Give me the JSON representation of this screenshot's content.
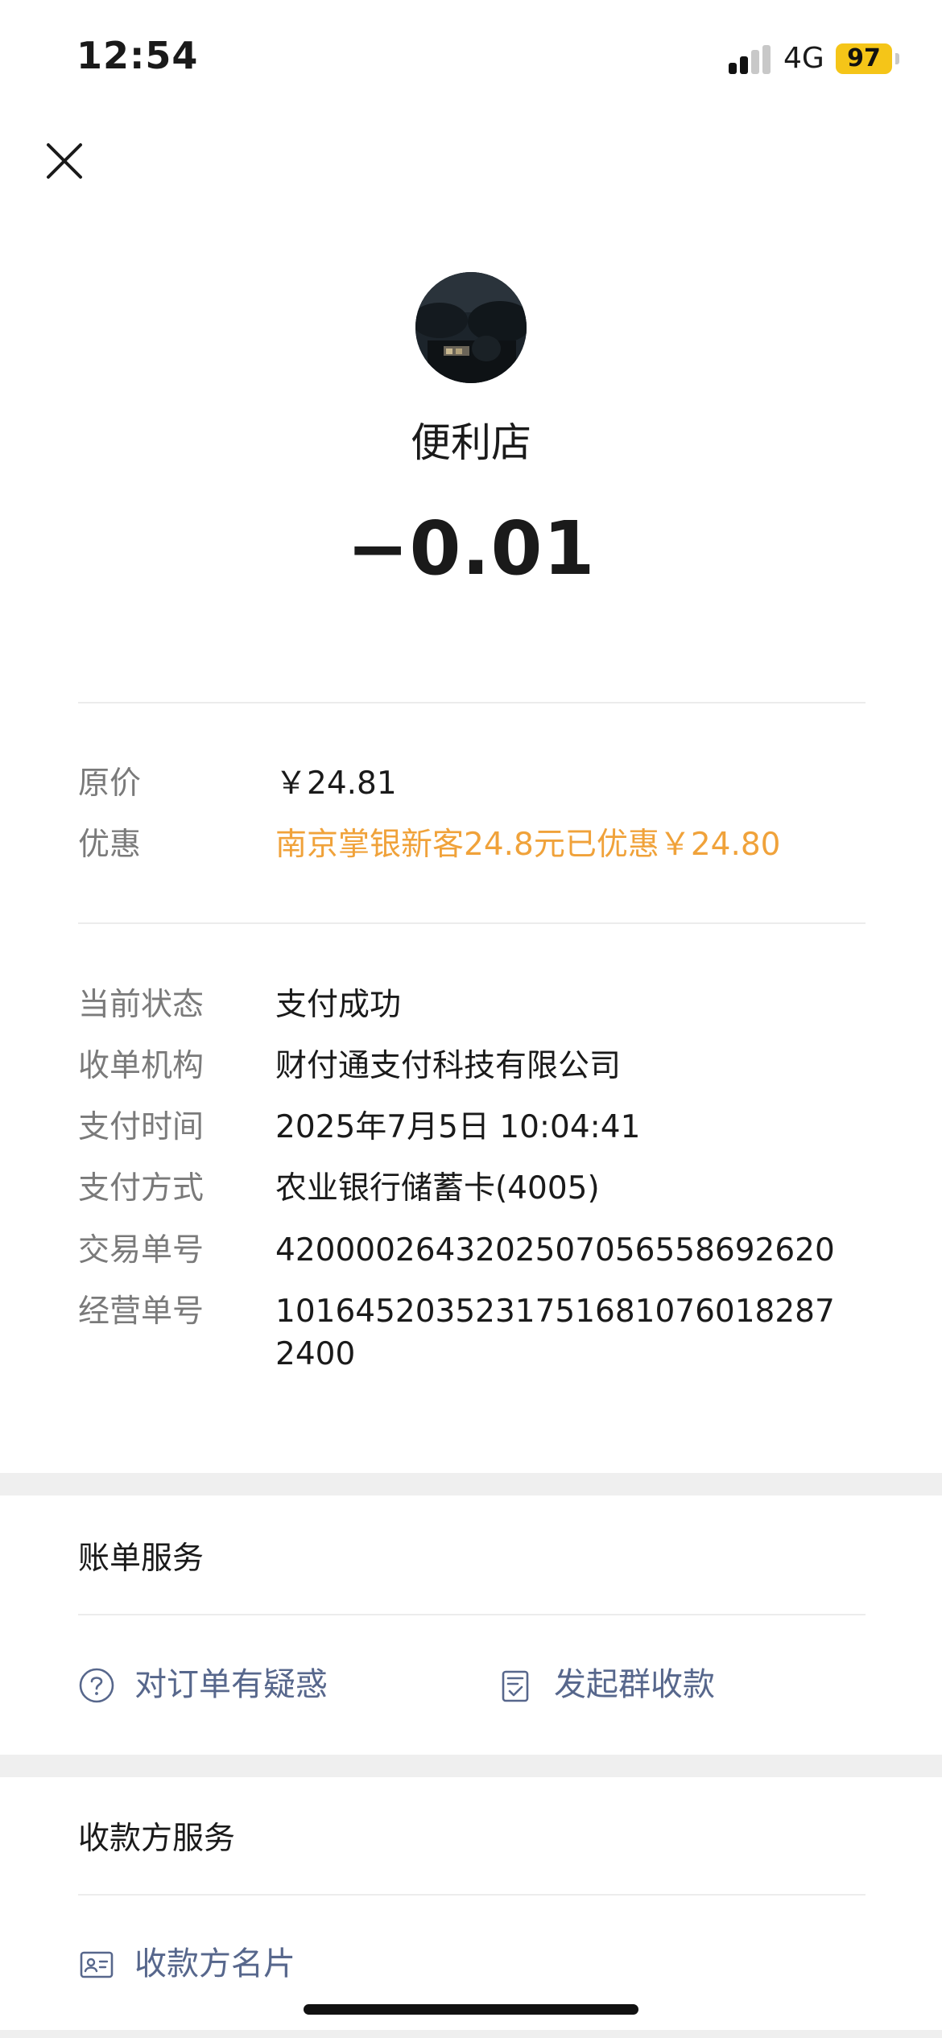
{
  "status_bar": {
    "time": "12:54",
    "network": "4G",
    "battery": "97"
  },
  "header": {
    "merchant_name": "便利店",
    "amount": "−0.01"
  },
  "price_info": [
    {
      "label": "原价",
      "value": "￥24.81",
      "highlight": false
    },
    {
      "label": "优惠",
      "value": "南京掌银新客24.8元已优惠￥24.80",
      "highlight": true
    }
  ],
  "details": [
    {
      "label": "当前状态",
      "value": "支付成功"
    },
    {
      "label": "收单机构",
      "value": "财付通支付科技有限公司"
    },
    {
      "label": "支付时间",
      "value": "2025年7月5日 10:04:41"
    },
    {
      "label": "支付方式",
      "value": "农业银行储蓄卡(4005)"
    },
    {
      "label": "交易单号",
      "value": "4200002643202507056558692620"
    },
    {
      "label": "经营单号",
      "value": "10164520352317516810760182872400"
    }
  ],
  "bill_service": {
    "title": "账单服务",
    "actions": [
      {
        "label": "对订单有疑惑",
        "icon": "question-circle-icon"
      },
      {
        "label": "发起群收款",
        "icon": "clipboard-check-icon"
      }
    ]
  },
  "payee_service": {
    "title": "收款方服务",
    "actions": [
      {
        "label": "收款方名片",
        "icon": "contact-card-icon"
      }
    ]
  },
  "colors": {
    "highlight_orange": "#f0a23a",
    "link_blue": "#57678c",
    "battery_yellow": "#f5c518"
  }
}
